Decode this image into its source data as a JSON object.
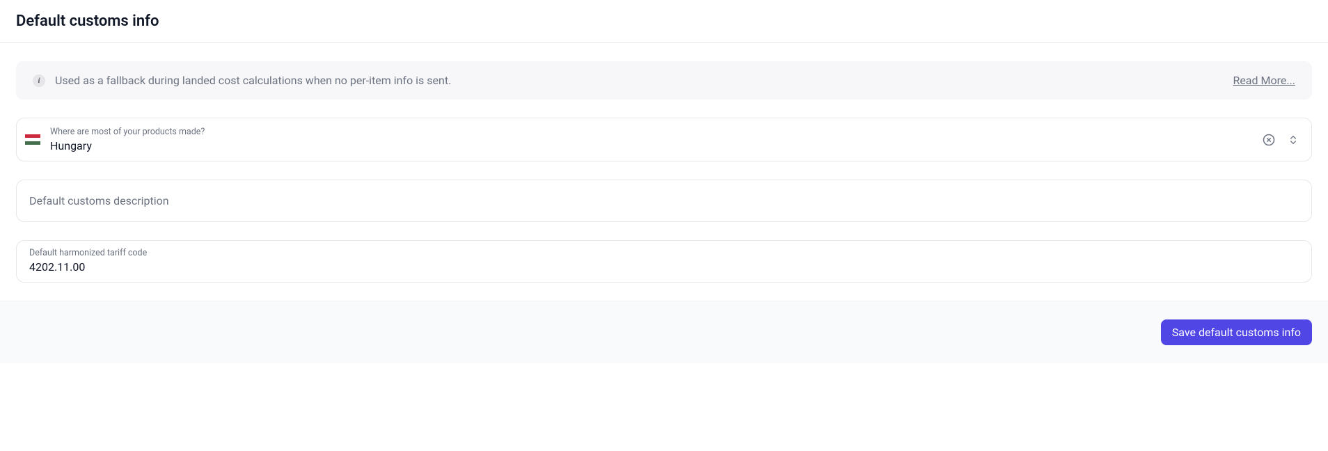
{
  "header": {
    "title": "Default customs info"
  },
  "info_banner": {
    "text": "Used as a fallback during landed cost calculations when no per-item info is sent.",
    "read_more": "Read More..."
  },
  "country_field": {
    "label": "Where are most of your products made?",
    "value": "Hungary"
  },
  "description_field": {
    "placeholder": "Default customs description",
    "value": ""
  },
  "tariff_field": {
    "label": "Default harmonized tariff code",
    "value": "4202.11.00"
  },
  "footer": {
    "save_label": "Save default customs info"
  }
}
